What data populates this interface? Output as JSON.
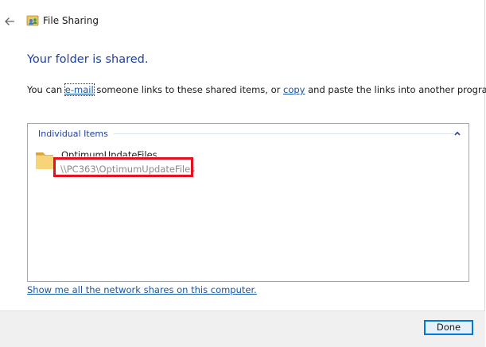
{
  "window": {
    "title": "File Sharing",
    "icons": {
      "back": "back-arrow-icon",
      "app": "file-sharing-icon"
    }
  },
  "main": {
    "heading": "Your folder is shared.",
    "instructions": {
      "prefix": "You can ",
      "email_link": "e-mail",
      "middle": " someone links to these shared items, or ",
      "copy_link": "copy",
      "suffix": " and paste the links into another program."
    }
  },
  "items_panel": {
    "group_label": "Individual Items",
    "collapse_icon": "chevron-up-icon",
    "items": [
      {
        "name": "OptimumUpdateFiles",
        "path": "\\\\PC363\\OptimumUpdateFiles",
        "icon": "folder-icon"
      }
    ]
  },
  "network_shares_link": "Show me all the network shares on this computer.",
  "footer": {
    "done_label": "Done"
  },
  "colors": {
    "heading": "#1e3f9e",
    "link": "#1556a8",
    "highlight": "#e8101e",
    "button_border": "#0078d7"
  }
}
